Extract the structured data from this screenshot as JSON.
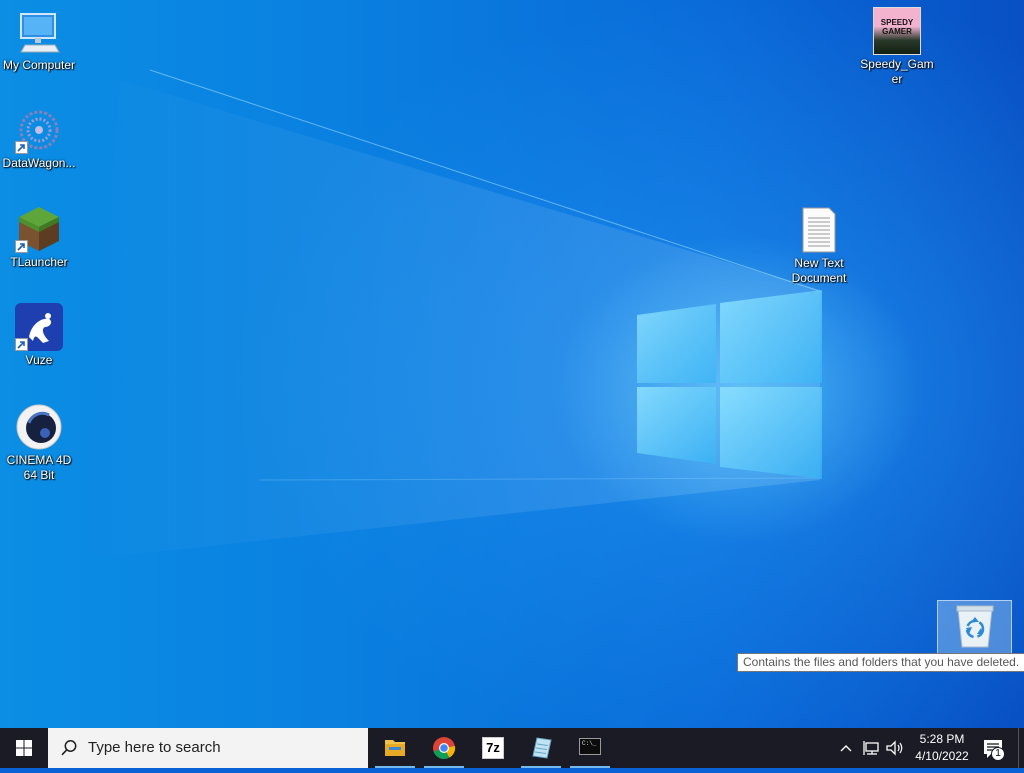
{
  "desktop": {
    "icons": [
      {
        "label": "My Computer",
        "icon": "computer-icon",
        "shortcut": false
      },
      {
        "label": "DataWagon...",
        "icon": "datawagon-icon",
        "shortcut": true
      },
      {
        "label": "TLauncher",
        "icon": "grass-block-icon",
        "shortcut": true
      },
      {
        "label": "Vuze",
        "icon": "vuze-frog-icon",
        "shortcut": true
      },
      {
        "label": "CINEMA 4D 64 Bit",
        "icon": "cinema4d-icon",
        "shortcut": false
      },
      {
        "label": "Speedy_Gamer",
        "icon": "speedy-gamer-image-icon",
        "shortcut": false
      },
      {
        "label": "New Text Document",
        "icon": "text-document-icon",
        "shortcut": false
      },
      {
        "label": "Recycle Bin",
        "icon": "recycle-bin-icon",
        "shortcut": false,
        "selected": true
      }
    ],
    "speedy_thumb_text": "SPEEDY GAMER",
    "tooltip": "Contains the files and folders that you have deleted."
  },
  "taskbar": {
    "search_placeholder": "Type here to search",
    "apps": [
      {
        "name": "File Explorer",
        "icon": "file-explorer-icon",
        "active": true
      },
      {
        "name": "Google Chrome",
        "icon": "chrome-icon",
        "active": true
      },
      {
        "name": "7-Zip",
        "icon": "7zip-icon",
        "active": false,
        "text": "7z"
      },
      {
        "name": "Notepad++",
        "icon": "notepad-icon",
        "active": true
      },
      {
        "name": "Command Prompt",
        "icon": "cmd-icon",
        "active": true,
        "text": "C:\\_"
      }
    ],
    "tray": {
      "time": "5:28 PM",
      "date": "4/10/2022",
      "notification_count": "1"
    }
  },
  "colors": {
    "taskbar_bg": "#1b1b25",
    "accent": "#76b9ed",
    "desktop_blue": "#0a7fe0"
  }
}
